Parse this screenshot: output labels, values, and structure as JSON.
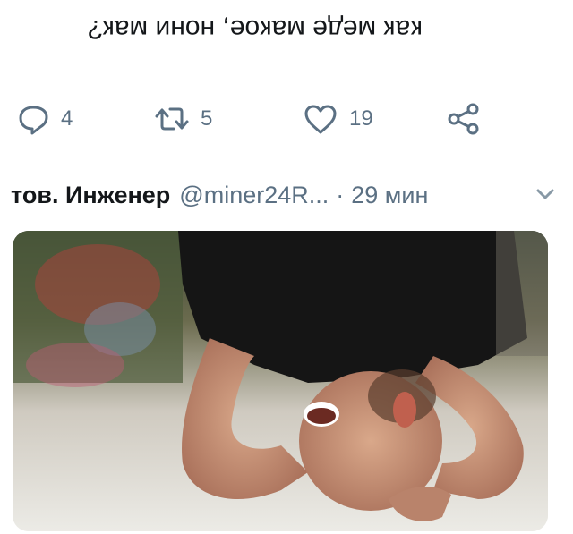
{
  "tweet": {
    "text": "как меде макое, нони мак?"
  },
  "actions": {
    "reply_count": "4",
    "retweet_count": "5",
    "like_count": "19"
  },
  "next_tweet": {
    "author_name": "тов. Инженер",
    "handle": "@miner24R...",
    "separator": "·",
    "time": "29 мин"
  },
  "icons": {
    "reply": "reply-icon",
    "retweet": "retweet-icon",
    "like": "heart-icon",
    "share": "share-icon",
    "caret": "chevron-down-icon"
  },
  "colors": {
    "text": "#14171a",
    "muted": "#5b7083"
  }
}
